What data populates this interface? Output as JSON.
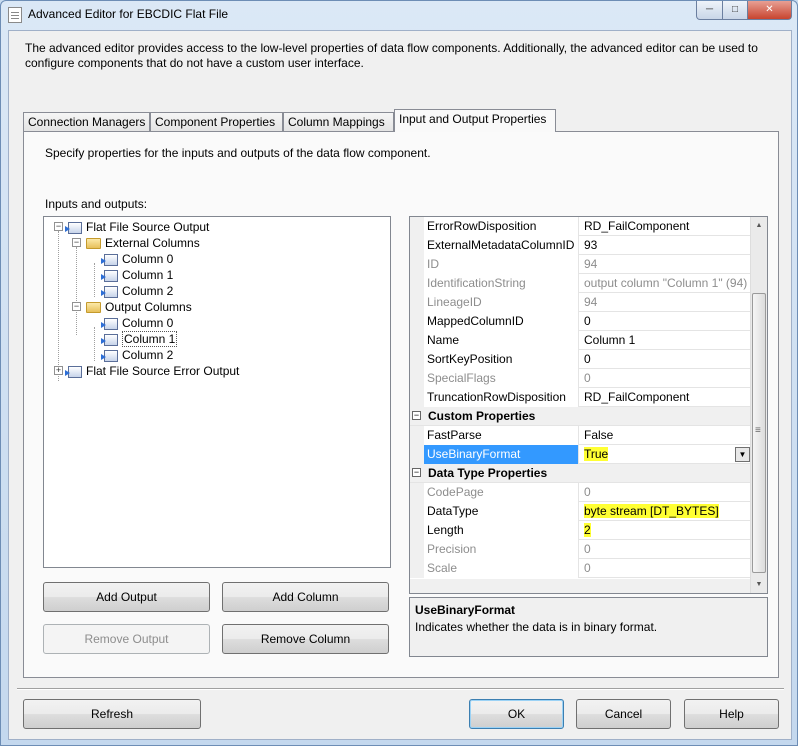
{
  "window": {
    "title": "Advanced Editor for EBCDIC Flat File",
    "minimize": "─",
    "maximize": "□",
    "close": "✕"
  },
  "description": "The advanced editor provides access to the low-level properties of data flow components. Additionally, the advanced editor can be used to configure components that do not have a custom user interface.",
  "tabs": [
    "Connection Managers",
    "Component Properties",
    "Column Mappings",
    "Input and Output Properties"
  ],
  "active_tab": "Input and Output Properties",
  "panel": {
    "description": "Specify properties for the inputs and outputs of the data flow component.",
    "io_label": "Inputs and outputs:"
  },
  "tree": [
    {
      "label": "Flat File Source Output",
      "level": 0,
      "expander": "−",
      "icon": "output-icon"
    },
    {
      "label": "External Columns",
      "level": 1,
      "expander": "−",
      "icon": "folder-icon"
    },
    {
      "label": "Column 0",
      "level": 2,
      "icon": "column-icon"
    },
    {
      "label": "Column 1",
      "level": 2,
      "icon": "column-icon"
    },
    {
      "label": "Column 2",
      "level": 2,
      "icon": "column-icon"
    },
    {
      "label": "Output Columns",
      "level": 1,
      "expander": "−",
      "icon": "folder-icon"
    },
    {
      "label": "Column 0",
      "level": 2,
      "icon": "column-icon"
    },
    {
      "label": "Column 1",
      "level": 2,
      "icon": "column-icon",
      "selected": true
    },
    {
      "label": "Column 2",
      "level": 2,
      "icon": "column-icon"
    },
    {
      "label": "Flat File Source Error Output",
      "level": 0,
      "expander": "+",
      "icon": "output-icon"
    }
  ],
  "buttons": {
    "add_output": "Add Output",
    "add_column": "Add Column",
    "remove_output": "Remove Output",
    "remove_column": "Remove Column",
    "refresh": "Refresh",
    "ok": "OK",
    "cancel": "Cancel",
    "help": "Help"
  },
  "properties": [
    {
      "name": "ErrorRowDisposition",
      "value": "RD_FailComponent"
    },
    {
      "name": "ExternalMetadataColumnID",
      "value": "93"
    },
    {
      "name": "ID",
      "value": "94",
      "readonly": true
    },
    {
      "name": "IdentificationString",
      "value": "output column \"Column 1\" (94)",
      "readonly": true
    },
    {
      "name": "LineageID",
      "value": "94",
      "readonly": true
    },
    {
      "name": "MappedColumnID",
      "value": "0"
    },
    {
      "name": "Name",
      "value": "Column 1"
    },
    {
      "name": "SortKeyPosition",
      "value": "0"
    },
    {
      "name": "SpecialFlags",
      "value": "0",
      "readonly": true
    },
    {
      "name": "TruncationRowDisposition",
      "value": "RD_FailComponent"
    },
    {
      "category": "Custom Properties",
      "expander": "−"
    },
    {
      "name": "FastParse",
      "value": "False"
    },
    {
      "name": "UseBinaryFormat",
      "value": "True",
      "selected": true,
      "highlight": true,
      "dropdown": "▼"
    },
    {
      "category": "Data Type Properties",
      "expander": "−"
    },
    {
      "name": "CodePage",
      "value": "0",
      "readonly": true
    },
    {
      "name": "DataType",
      "value": "byte stream [DT_BYTES]",
      "highlight": true
    },
    {
      "name": "Length",
      "value": "2",
      "highlight": true
    },
    {
      "name": "Precision",
      "value": "0",
      "readonly": true
    },
    {
      "name": "Scale",
      "value": "0",
      "readonly": true
    }
  ],
  "scrollbar": {
    "up": "▲",
    "down": "▼",
    "grip": "≡"
  },
  "help": {
    "title": "UseBinaryFormat",
    "text": "Indicates whether the data is in binary format."
  },
  "colors": {
    "selection": "#3399ff",
    "highlight": "#ffff33"
  }
}
